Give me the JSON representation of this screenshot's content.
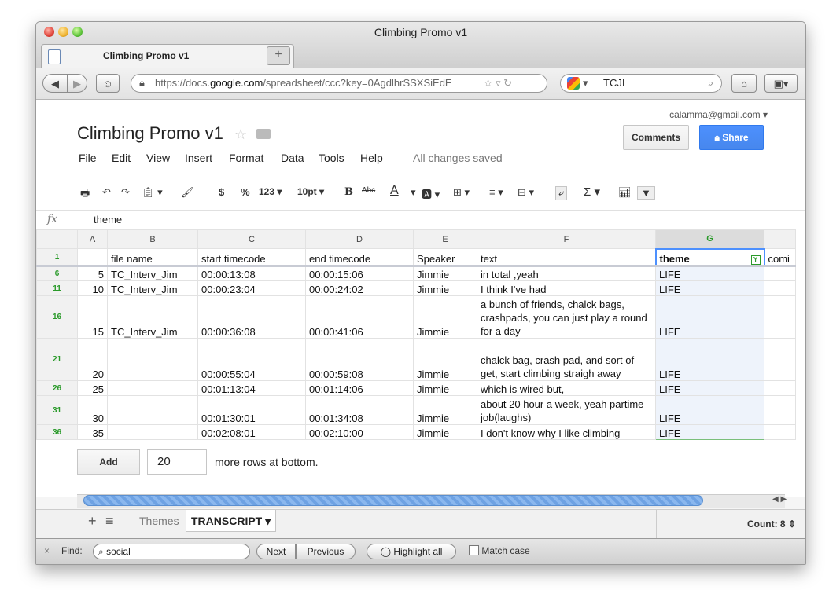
{
  "window": {
    "title": "Climbing Promo v1"
  },
  "browser": {
    "tab_title": "Climbing Promo v1",
    "url_prefix": "https://docs.",
    "url_domain": "google.com",
    "url_path": "/spreadsheet/ccc?key=0AgdlhrSSXSiEdE",
    "search_text": "TCJI"
  },
  "docs": {
    "title": "Climbing Promo v1",
    "email": "calamma@gmail.com",
    "comments_label": "Comments",
    "share_label": "Share",
    "status": "All changes saved",
    "menu": [
      "File",
      "Edit",
      "View",
      "Insert",
      "Format",
      "Data",
      "Tools",
      "Help"
    ]
  },
  "toolbar": {
    "currency": "$",
    "percent": "%",
    "number_format": "123",
    "font_size": "10pt",
    "bold": "B",
    "strike": "Abc",
    "text_color": "A",
    "sum": "Σ"
  },
  "formula_bar": {
    "fx": "fx",
    "value": "theme"
  },
  "grid": {
    "col_letters": [
      "A",
      "B",
      "C",
      "D",
      "E",
      "F",
      "G"
    ],
    "headers": [
      "file name",
      "start timecode",
      "end timecode",
      "Speaker",
      "text",
      "theme",
      "comi"
    ],
    "rows": [
      {
        "n": "1"
      },
      {
        "n": "6",
        "a": "5",
        "b": "TC_Interv_Jim",
        "c": "00:00:13:08",
        "d": "00:00:15:06",
        "e": "Jimmie",
        "f": "in total ,yeah",
        "g": "LIFE"
      },
      {
        "n": "11",
        "a": "10",
        "b": "TC_Interv_Jim",
        "c": "00:00:23:04",
        "d": "00:00:24:02",
        "e": "Jimmie",
        "f": "I think I've had",
        "g": "LIFE"
      },
      {
        "n": "16",
        "a": "15",
        "b": "TC_Interv_Jim",
        "c": "00:00:36:08",
        "d": "00:00:41:06",
        "e": "Jimmie",
        "f": "a bunch of friends, chalck bags, crashpads, you can just play a round for a day",
        "g": "LIFE"
      },
      {
        "n": "21",
        "a": "20",
        "b": "",
        "c": "00:00:55:04",
        "d": "00:00:59:08",
        "e": "Jimmie",
        "f": "chalck bag, crash pad, and sort of get, start climbing straigh away",
        "g": "LIFE"
      },
      {
        "n": "26",
        "a": "25",
        "b": "",
        "c": "00:01:13:04",
        "d": "00:01:14:06",
        "e": "Jimmie",
        "f": "which is wired but,",
        "g": "LIFE"
      },
      {
        "n": "31",
        "a": "30",
        "b": "",
        "c": "00:01:30:01",
        "d": "00:01:34:08",
        "e": "Jimmie",
        "f": "about 20 hour a week, yeah partime job(laughs)",
        "g": "LIFE"
      },
      {
        "n": "36",
        "a": "35",
        "b": "",
        "c": "00:02:08:01",
        "d": "00:02:10:00",
        "e": "Jimmie",
        "f": "I don't know why I like climbing",
        "g": "LIFE"
      }
    ]
  },
  "add_rows": {
    "button": "Add",
    "count": "20",
    "suffix": "more rows at bottom."
  },
  "sheets": {
    "add": "+",
    "list": "≡",
    "tabs": [
      "Themes",
      "TRANSCRIPT"
    ],
    "count": "Count: 8"
  },
  "find": {
    "label": "Find:",
    "query": "social",
    "next": "Next",
    "previous": "Previous",
    "highlight": "Highlight all",
    "match_case": "Match case"
  }
}
